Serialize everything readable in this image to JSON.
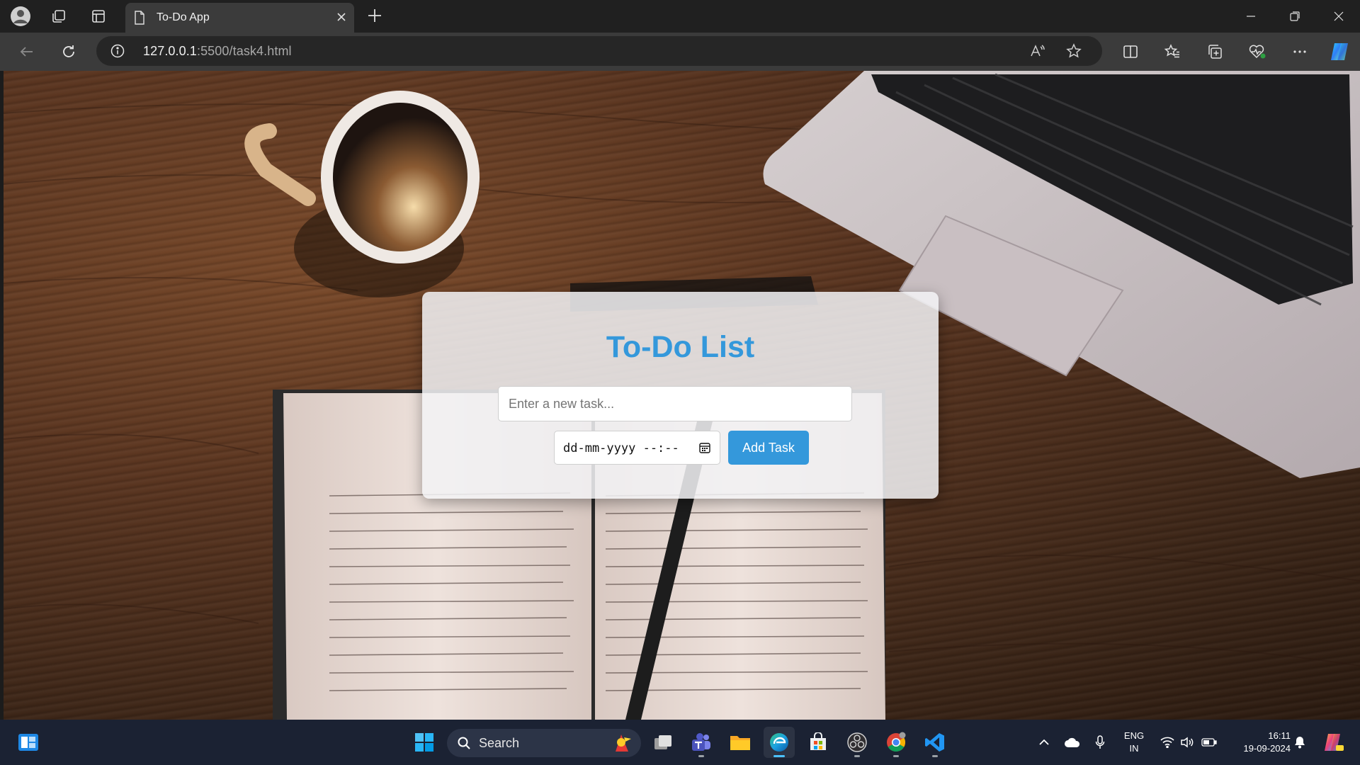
{
  "browser": {
    "tab_title": "To-Do App",
    "url_host": "127.0.0.1",
    "url_rest": ":5500/task4.html"
  },
  "page": {
    "heading": "To-Do List",
    "task_input": {
      "placeholder": "Enter a new task...",
      "value": ""
    },
    "datetime_input": {
      "display": "dd-mm-yyyy --:--"
    },
    "add_button": "Add Task",
    "colors": {
      "accent": "#3498db",
      "card_bg": "#f2f2f4"
    }
  },
  "taskbar": {
    "search_label": "Search",
    "language_line1": "ENG",
    "language_line2": "IN",
    "time": "16:11",
    "date": "19-09-2024",
    "apps": [
      "start-icon",
      "task-view-icon",
      "teams-icon",
      "file-explorer-icon",
      "edge-icon",
      "store-icon",
      "obs-icon",
      "chrome-icon",
      "vscode-icon"
    ]
  }
}
